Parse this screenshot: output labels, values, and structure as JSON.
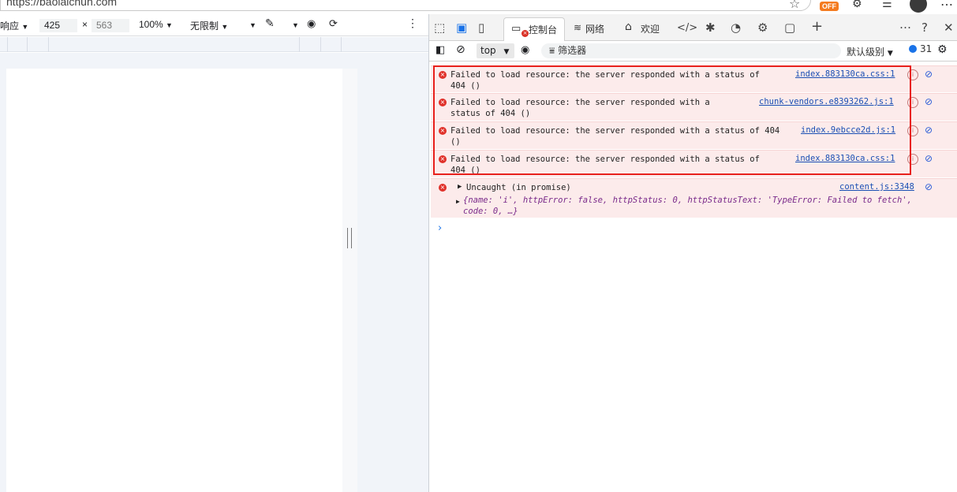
{
  "address": {
    "url": "https://baolaichun.com",
    "ext_badge": "OFF"
  },
  "emulation": {
    "mode_label": "响应",
    "width": "425",
    "times": "×",
    "height": "563",
    "zoom": "100%",
    "throttle": "无限制"
  },
  "devtools": {
    "tabs": [
      {
        "label": "控制台"
      },
      {
        "label": "网络"
      },
      {
        "label": "欢迎"
      }
    ],
    "toolbar": {
      "context": "top",
      "filter_placeholder": "筛选器",
      "level": "默认级别",
      "message_count": "31"
    }
  },
  "console": {
    "messages": [
      {
        "text_line1": "Failed to load resource: the server responded with a status of",
        "text_line2": "404 ()",
        "source": "index.883130ca.css:1"
      },
      {
        "text_line1": "Failed to load resource: the server responded with a",
        "text_line2": "status of 404 ()",
        "source": "chunk-vendors.e8393262.js:1"
      },
      {
        "text_line1": "Failed to load resource: the server responded with a status of 404",
        "text_line2": "()",
        "source": "index.9ebcce2d.js:1"
      },
      {
        "text_line1": "Failed to load resource: the server responded with a status of",
        "text_line2": "404 ()",
        "source": "index.883130ca.css:1"
      }
    ],
    "uncaught": {
      "label": "Uncaught (in promise)",
      "source": "content.js:3348",
      "object_line1": "{name: 'i', httpError: false, httpStatus: 0, httpStatusText: 'TypeError: Failed to fetch',",
      "object_line2": "code: 0, …}"
    },
    "prompt": "›"
  },
  "colors": {
    "error_bg": "#fcebeb",
    "error_icon": "#e0312a",
    "highlight": "#e8201c",
    "link": "#1a4fb4"
  }
}
